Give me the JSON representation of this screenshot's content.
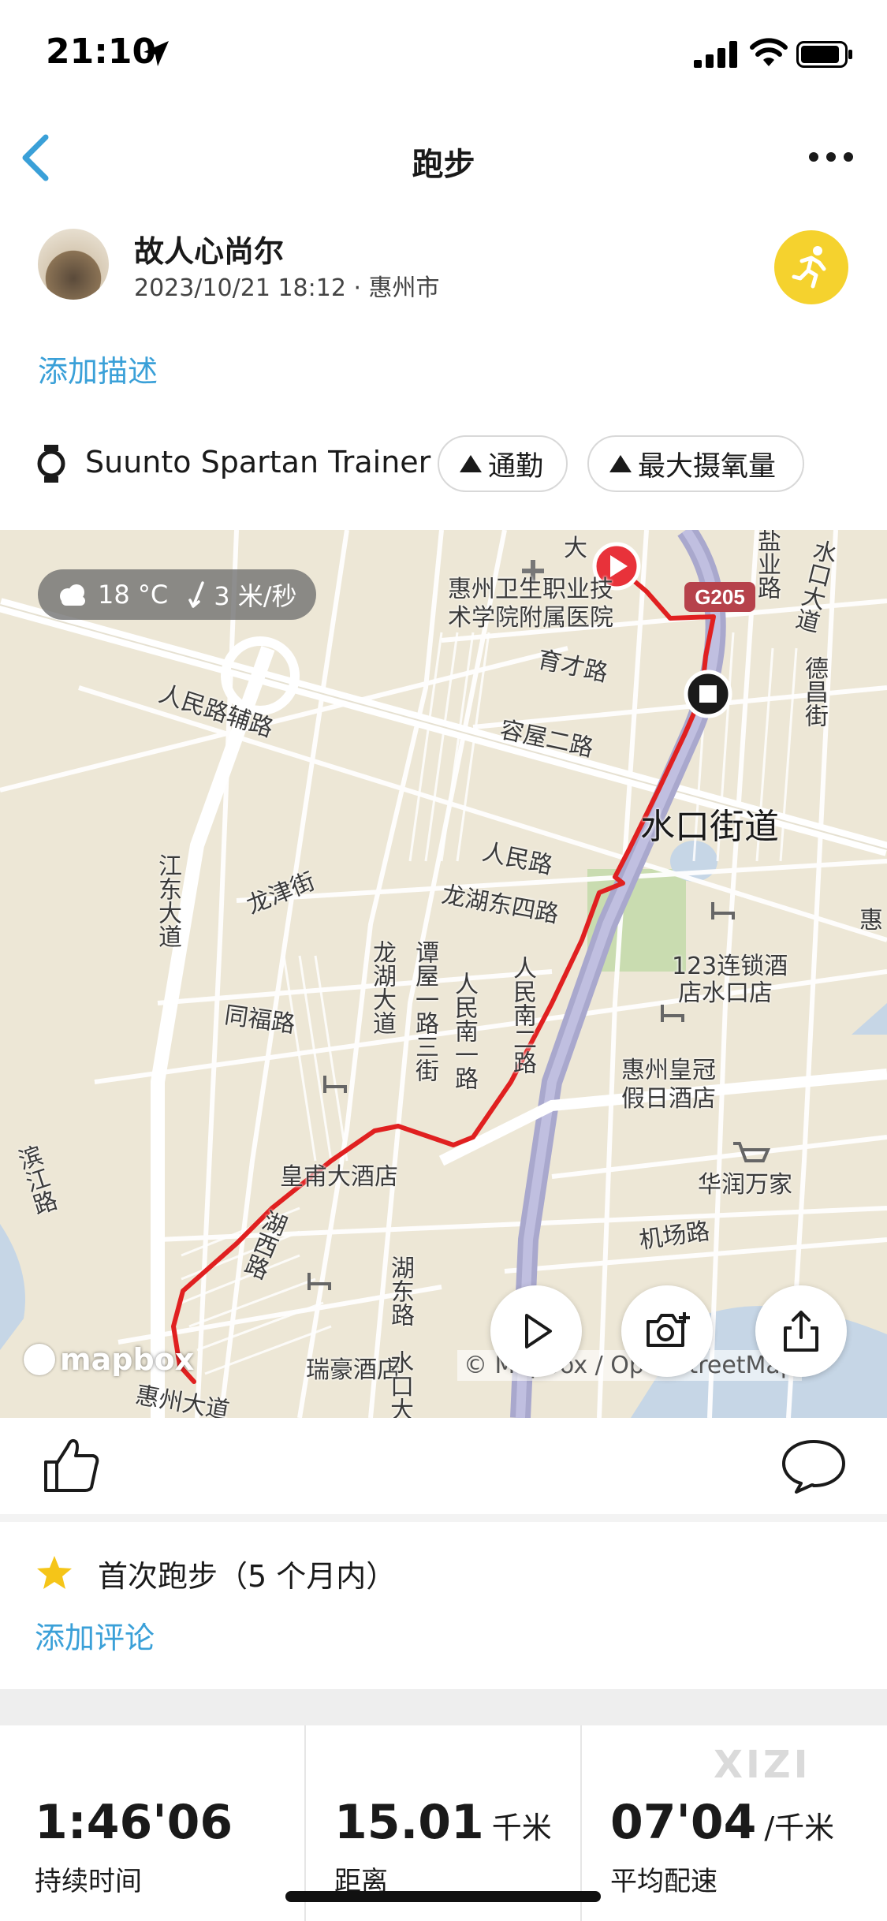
{
  "status_bar": {
    "time": "21:10"
  },
  "nav": {
    "title": "跑步"
  },
  "header": {
    "user_name": "故人心尚尔",
    "meta": "2023/10/21 18:12 · 惠州市",
    "add_description": "添加描述"
  },
  "device": {
    "name": "Suunto Spartan Trainer",
    "tags": [
      "通勤",
      "最大摄氧量"
    ]
  },
  "map": {
    "weather": {
      "temperature": "18 °C",
      "wind": "3 米/秒"
    },
    "labels": {
      "road_g205": "G205",
      "hospital": "惠州卫生职业技",
      "hospital2": "术学院附属医院",
      "yucai": "育才路",
      "rongwu": "容屋二路",
      "shuikou": "水口街道",
      "renmin_fulu": "人民路辅路",
      "renmin": "人民路",
      "longhu_east4": "龙湖东四路",
      "jiangdong": "江东大道",
      "longjin": "龙津街",
      "tanwu": "谭屋一路三街",
      "renmin_south1": "人民南一路",
      "renmin_south2": "人民南二路",
      "longhu": "龙湖大道",
      "tongfu": "同福路",
      "hotel123": "123连锁酒",
      "hotel123b": "店水口店",
      "huangguan": "惠州皇冠",
      "huangguan2": "假日酒店",
      "huangfu": "皇甫大酒店",
      "huarun": "华润万家",
      "jichang": "机场路",
      "binjiang": "滨江路",
      "huxi": "湖西路",
      "hudong": "湖东路",
      "ruihao": "瑞豪酒店",
      "huizhou_dadao": "惠州大道",
      "shuikou_dadao": "水口大道",
      "shuikou_road": "水口大",
      "deshi": "德昌街",
      "yanye": "盐业路",
      "hui_edge": "惠",
      "da": "大"
    },
    "mapbox_logo": "mapbox",
    "attribution": "© Mapbox / OpenStreetMap",
    "route_color": "#e02020"
  },
  "achievement": {
    "text": "首次跑步（5 个月内）",
    "add_comment": "添加评论"
  },
  "stats": [
    {
      "value": "1:46'06",
      "unit": "",
      "label": "持续时间"
    },
    {
      "value": "15.01",
      "unit": "千米",
      "label": "距离"
    },
    {
      "value": "07'04",
      "unit": "/千米",
      "label": "平均配速"
    }
  ],
  "watermark": "XIZI",
  "colors": {
    "link": "#3aa0d8",
    "badge": "#f5d22e",
    "route": "#e02020"
  }
}
